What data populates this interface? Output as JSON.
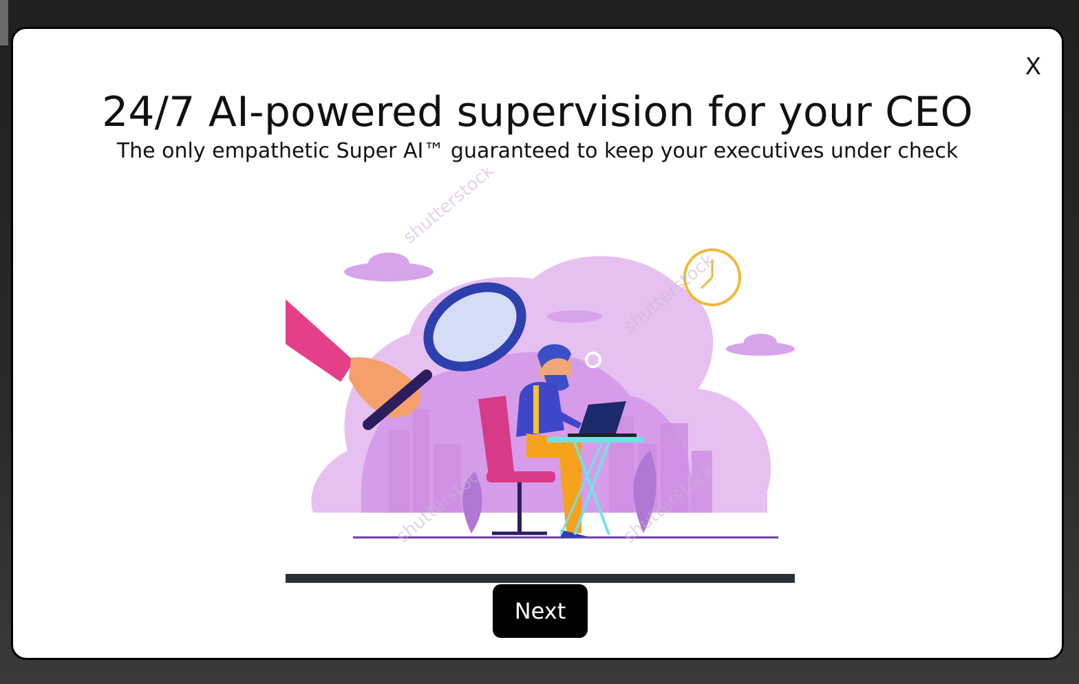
{
  "modal": {
    "close_label": "X",
    "title": "24/7 AI-powered supervision for your CEO",
    "subtitle": "The only empathetic Super AI™ guaranteed to keep your executives under check",
    "next_label": "Next"
  },
  "illustration": {
    "watermark_text": "shutterstock",
    "icon": "supervision-illustration"
  },
  "progress": {
    "value": 1.0
  },
  "colors": {
    "accent": "#000000",
    "illustration_purple": "#d9a3ec",
    "progress_bar": "#2b2f36"
  }
}
